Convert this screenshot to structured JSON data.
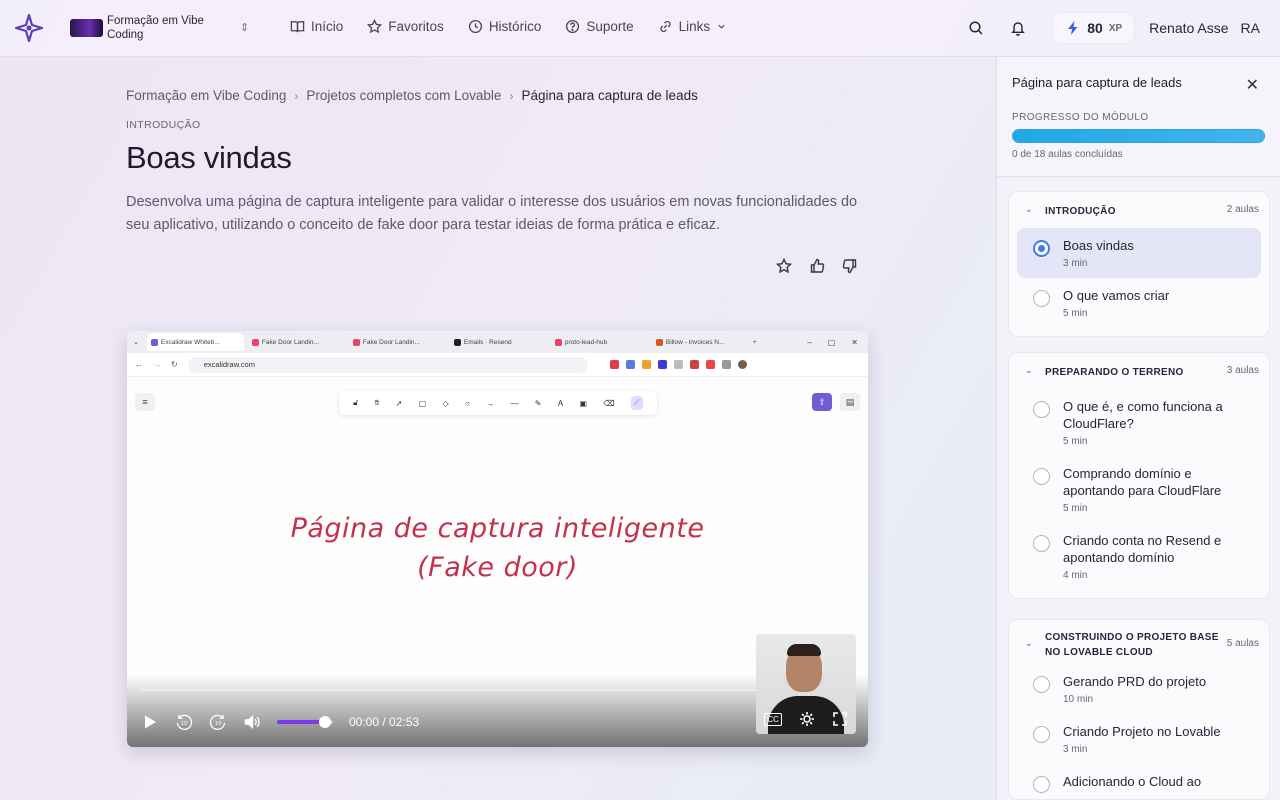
{
  "topbar": {
    "course_name": "Formação em Vibe Coding",
    "nav": [
      {
        "label": "Início",
        "icon": "book-icon"
      },
      {
        "label": "Favoritos",
        "icon": "star-icon"
      },
      {
        "label": "Histórico",
        "icon": "clock-icon"
      },
      {
        "label": "Suporte",
        "icon": "help-icon"
      },
      {
        "label": "Links",
        "icon": "link-icon"
      }
    ],
    "xp_value": "80",
    "xp_unit": "XP",
    "user_name": "Renato Asse",
    "user_initials": "RA"
  },
  "breadcrumb": {
    "items": [
      "Formação em Vibe Coding",
      "Projetos completos com Lovable",
      "Página para captura de leads"
    ]
  },
  "lesson": {
    "section": "INTRODUÇÃO",
    "title": "Boas vindas",
    "description": "Desenvolva uma página de captura inteligente para validar o interesse dos usuários em novas funcionalidades do seu aplicativo, utilizando o conceito de fake door para testar ideias de forma prática e eficaz."
  },
  "video": {
    "browser_tabs": [
      "Excalidraw Whiteb...",
      "Fake Door Landin...",
      "Fake Door Landin...",
      "Emails · Resend",
      "proto-lead-hub",
      "Billow - Invoices N..."
    ],
    "url": "excalidraw.com",
    "handwritten_line1": "Página de captura inteligente",
    "handwritten_line2": "(Fake door)",
    "time": "00:00 / 02:53",
    "volume_fraction": 0.85,
    "playback_fraction": 0.0,
    "cc_label": "CC"
  },
  "sidebar": {
    "title": "Página para captura de leads",
    "progress_label": "PROGRESSO DO MÓDULO",
    "progress_fraction": 1.0,
    "progress_text": "0 de 18 aulas concluídas",
    "modules": [
      {
        "title": "INTRODUÇÃO",
        "count": "2 aulas",
        "lessons": [
          {
            "title": "Boas vindas",
            "duration": "3 min",
            "active": true
          },
          {
            "title": "O que vamos criar",
            "duration": "5 min",
            "active": false
          }
        ]
      },
      {
        "title": "PREPARANDO O TERRENO",
        "count": "3 aulas",
        "lessons": [
          {
            "title": "O que é, e como funciona a CloudFlare?",
            "duration": "5 min",
            "active": false
          },
          {
            "title": "Comprando domínio e apontando para CloudFlare",
            "duration": "5 min",
            "active": false
          },
          {
            "title": "Criando conta no Resend e apontando domínio",
            "duration": "4 min",
            "active": false
          }
        ]
      },
      {
        "title": "CONSTRUINDO O PROJETO BASE NO LOVABLE CLOUD",
        "count": "5 aulas",
        "lessons": [
          {
            "title": "Gerando PRD do projeto",
            "duration": "10 min",
            "active": false
          },
          {
            "title": "Criando Projeto no Lovable",
            "duration": "3 min",
            "active": false
          },
          {
            "title": "Adicionando o Cloud ao",
            "duration": "",
            "active": false
          }
        ]
      }
    ]
  }
}
